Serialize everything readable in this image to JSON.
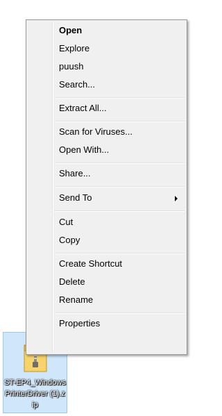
{
  "desktop_icon": {
    "label": "ST-EP4_WindowsPrinterDriver (1).zip",
    "icon": "zip-folder-icon"
  },
  "context_menu": {
    "items": [
      {
        "label": "Open",
        "bold": true
      },
      {
        "label": "Explore"
      },
      {
        "label": "puush"
      },
      {
        "label": "Search..."
      },
      {
        "label": "Extract All..."
      },
      {
        "label": "Scan for Viruses..."
      },
      {
        "label": "Open With..."
      },
      {
        "label": "Share..."
      },
      {
        "label": "Send To",
        "submenu": true
      },
      {
        "label": "Cut"
      },
      {
        "label": "Copy"
      },
      {
        "label": "Create Shortcut"
      },
      {
        "label": "Delete"
      },
      {
        "label": "Rename"
      },
      {
        "label": "Properties"
      }
    ]
  }
}
